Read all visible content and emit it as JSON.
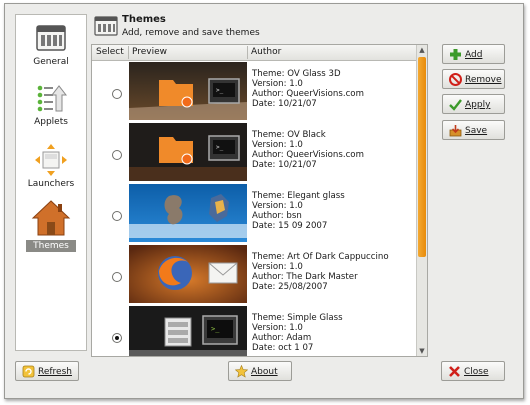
{
  "header": {
    "title": "Themes",
    "subtitle": "Add, remove and save themes"
  },
  "sidebar": {
    "items": [
      {
        "label": "General",
        "selected": false,
        "icon": "general-icon"
      },
      {
        "label": "Applets",
        "selected": false,
        "icon": "applets-icon"
      },
      {
        "label": "Launchers",
        "selected": false,
        "icon": "launchers-icon"
      },
      {
        "label": "Themes",
        "selected": true,
        "icon": "house-icon"
      }
    ]
  },
  "table": {
    "columns": [
      "Select",
      "Preview",
      "Author"
    ],
    "rows": [
      {
        "theme": "Theme: OV Glass 3D",
        "version": "Version: 1.0",
        "author": "Author: QueerVisions.com",
        "date": "Date: 10/21/07",
        "selected": false,
        "preview": "ov-glass-3d-preview"
      },
      {
        "theme": "Theme: OV Black",
        "version": "Version: 1.0",
        "author": "Author: QueerVisions.com",
        "date": "Date: 10/21/07",
        "selected": false,
        "preview": "ov-black-preview"
      },
      {
        "theme": "Theme: Elegant glass",
        "version": "Version: 1.0",
        "author": "Author: bsn",
        "date": "Date: 15 09 2007",
        "selected": false,
        "preview": "elegant-glass-preview"
      },
      {
        "theme": "Theme: Art Of Dark Cappuccino",
        "version": "Version: 1.0",
        "author": "Author: The Dark Master",
        "date": "Date: 25/08/2007",
        "selected": false,
        "preview": "dark-cappuccino-preview"
      },
      {
        "theme": "Theme: Simple Glass",
        "version": "Version: 1.0",
        "author": "Author: Adam",
        "date": "Date: oct 1 07",
        "selected": true,
        "preview": "simple-glass-preview"
      }
    ]
  },
  "actions": {
    "add": "Add",
    "remove": "Remove",
    "apply": "Apply",
    "save": "Save"
  },
  "footer": {
    "refresh": "Refresh",
    "about": "About",
    "close": "Close"
  },
  "colors": {
    "scroll_thumb": "#e88b0a",
    "selected_nav": "#8a8a86",
    "accent_orange": "#f0852a"
  }
}
